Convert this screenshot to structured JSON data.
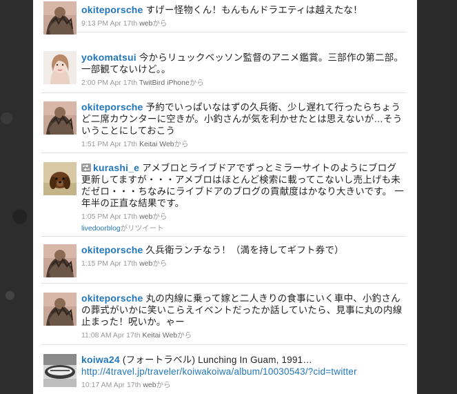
{
  "tweets": [
    {
      "user": "okiteporsche",
      "text": "すげー怪物くん！もんもんドラエティは越えたな！",
      "time": "9:13 PM Apr 17th",
      "source": "web",
      "suffix": "から",
      "avatar": "okite"
    },
    {
      "user": "yokomatsui",
      "text": "今からリュックベッソン監督のアニメ鑑賞。三部作の第二部。一部観てないけど。。",
      "time": "2:00 PM Apr 17th",
      "source": "TwitBird iPhone",
      "suffix": "から",
      "avatar": "yoko"
    },
    {
      "user": "okiteporsche",
      "text": "予約でいっぱいなはずの久兵衛、少し遅れて行ったらちょうど二席カウンターに空きが。小釣さんが気を利かせたとは思えないが…そういうことにしておこう",
      "time": "1:51 PM Apr 17th",
      "source": "Keitai Web",
      "suffix": "から",
      "avatar": "okite"
    },
    {
      "user": "kurashi_e",
      "text": "アメブロとライブドアでずっとミラーサイトのようにブログ更新してますが・・・アメブロはほとんど検索に載ってこないし売上げも未だゼロ・・・ちなみにライブドアのブログの貢献度はかなり大きいです。 一年半の正直な結果です。",
      "time": "1:05 PM Apr 17th",
      "source": "web",
      "suffix": "から",
      "avatar": "kura",
      "retweet_by": "livedoorblog",
      "retweet_suffix": "がリツイート"
    },
    {
      "user": "okiteporsche",
      "text": "久兵衛ランチなう！（満を持してギフト券で）",
      "time": "1:15 PM Apr 17th",
      "source": "web",
      "suffix": "から",
      "avatar": "okite"
    },
    {
      "user": "okiteporsche",
      "text": "丸の内線に乗って嫁と二人きりの食事にいく車中、小釣さんの葬式がいかに笑いこらえイベントだったか話していたら、見事に丸の内線止まった！呪いか。ゃー",
      "time": "11:08 AM Apr 17th",
      "source": "Keitai Web",
      "suffix": "から",
      "avatar": "okite"
    },
    {
      "user": "koiwa24",
      "text": "(フォートラベル) Lunching In Guam, 1991…",
      "link": "http://4travel.jp/traveler/koiwakoiwa/album/10030543/?cid=twitter",
      "time": "10:17 AM Apr 17th",
      "source": "web",
      "suffix": "から",
      "avatar": "koiwa"
    }
  ]
}
